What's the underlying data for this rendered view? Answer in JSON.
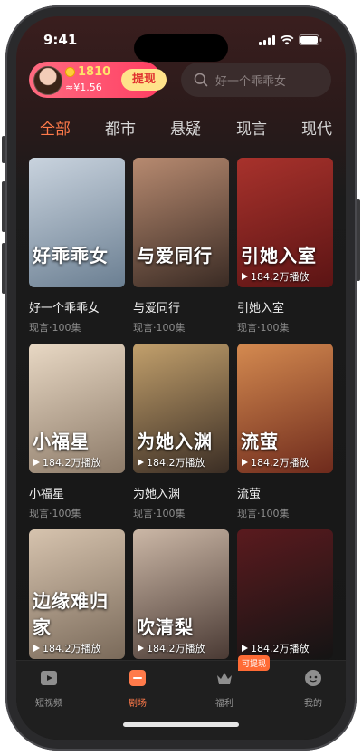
{
  "status_bar": {
    "time": "9:41"
  },
  "header": {
    "coins": "1810",
    "cash": "≈¥1.56",
    "withdraw_label": "提现",
    "search_placeholder": "好一个乖乖女"
  },
  "tabs": [
    {
      "label": "全部",
      "active": true
    },
    {
      "label": "都市",
      "active": false
    },
    {
      "label": "悬疑",
      "active": false
    },
    {
      "label": "现言",
      "active": false
    },
    {
      "label": "现代",
      "active": false
    }
  ],
  "dramas": [
    {
      "title": "好一个乖乖女",
      "meta": "现言·100集",
      "plays": "",
      "poster_text": "好乖乖女",
      "colors": [
        "#6b7f92",
        "#c9d3de"
      ]
    },
    {
      "title": "与爱同行",
      "meta": "现言·100集",
      "plays": "",
      "poster_text": "与爱同行",
      "colors": [
        "#3a2b24",
        "#b78a70"
      ]
    },
    {
      "title": "引她入室",
      "meta": "现言·100集",
      "plays": "184.2万播放",
      "poster_text": "引她入室",
      "colors": [
        "#5b1414",
        "#a8322c"
      ]
    },
    {
      "title": "小福星",
      "meta": "现言·100集",
      "plays": "184.2万播放",
      "poster_text": "小福星",
      "colors": [
        "#8c7a68",
        "#e8d8c4"
      ]
    },
    {
      "title": "为她入渊",
      "meta": "现言·100集",
      "plays": "184.2万播放",
      "poster_text": "为她入渊",
      "colors": [
        "#3a2d24",
        "#c2a06c"
      ]
    },
    {
      "title": "流萤",
      "meta": "现言·100集",
      "plays": "184.2万播放",
      "poster_text": "流萤",
      "colors": [
        "#6e2a1c",
        "#d48a50"
      ]
    },
    {
      "title": "",
      "meta": "",
      "plays": "184.2万播放",
      "poster_text": "边缘难归家",
      "colors": [
        "#7a6a5a",
        "#d6c3ae"
      ]
    },
    {
      "title": "",
      "meta": "",
      "plays": "184.2万播放",
      "poster_text": "吹清梨",
      "colors": [
        "#4a3a34",
        "#cbb7a6"
      ]
    },
    {
      "title": "",
      "meta": "",
      "plays": "184.2万播放",
      "poster_text": "",
      "colors": [
        "#141414",
        "#5a1a1e"
      ]
    }
  ],
  "tabbar": {
    "items": [
      {
        "label": "短视频",
        "icon": "video-icon",
        "active": false
      },
      {
        "label": "剧场",
        "icon": "theater-icon",
        "active": true
      },
      {
        "label": "福利",
        "icon": "crown-icon",
        "active": false
      },
      {
        "label": "我的",
        "icon": "profile-icon",
        "active": false
      }
    ],
    "badge": "可提现"
  },
  "colors": {
    "accent": "#ff7a4a",
    "pill": "#ff4a6a",
    "withdraw_bg": "#ffe28a"
  }
}
